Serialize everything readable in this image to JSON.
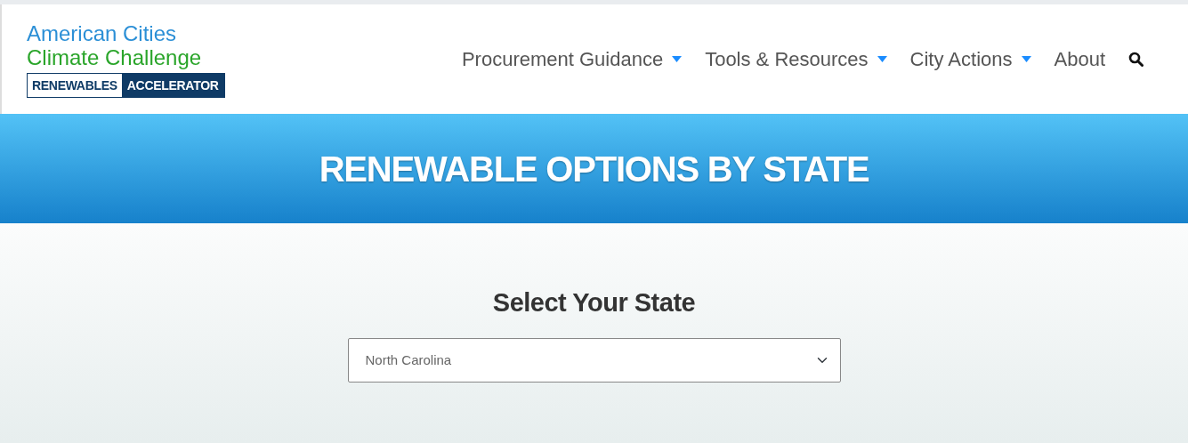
{
  "logo": {
    "line_1": "American Cities",
    "line_2": "Climate Challenge",
    "badge_left": "RENEWABLES",
    "badge_right": "ACCELERATOR"
  },
  "nav": [
    {
      "label": "Procurement Guidance",
      "dropdown": true
    },
    {
      "label": "Tools & Resources",
      "dropdown": true
    },
    {
      "label": "City Actions",
      "dropdown": true
    },
    {
      "label": "About",
      "dropdown": false
    }
  ],
  "banner": {
    "title": "RENEWABLE OPTIONS BY STATE"
  },
  "selector": {
    "heading": "Select Your State",
    "value": "North Carolina"
  }
}
